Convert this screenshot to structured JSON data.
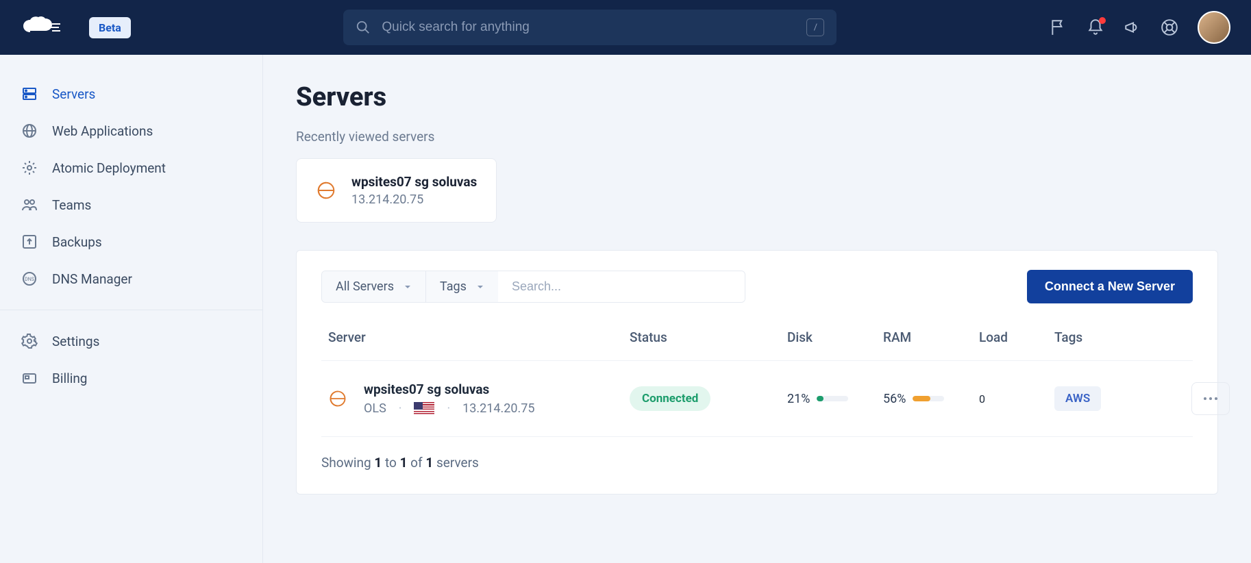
{
  "header": {
    "beta_label": "Beta",
    "search_placeholder": "Quick search for anything",
    "kbd_hint": "/"
  },
  "sidebar": {
    "items": [
      {
        "label": "Servers",
        "icon": "server-icon",
        "active": true
      },
      {
        "label": "Web Applications",
        "icon": "globe-icon",
        "active": false
      },
      {
        "label": "Atomic Deployment",
        "icon": "gear-outline-icon",
        "active": false
      },
      {
        "label": "Teams",
        "icon": "users-icon",
        "active": false
      },
      {
        "label": "Backups",
        "icon": "upload-box-icon",
        "active": false
      },
      {
        "label": "DNS Manager",
        "icon": "dns-icon",
        "active": false
      }
    ],
    "footer": [
      {
        "label": "Settings",
        "icon": "gear-icon"
      },
      {
        "label": "Billing",
        "icon": "card-icon"
      }
    ]
  },
  "page": {
    "title": "Servers",
    "recent_heading": "Recently viewed servers",
    "recent": [
      {
        "name": "wpsites07 sg soluvas",
        "ip": "13.214.20.75"
      }
    ],
    "filters": {
      "scope": "All Servers",
      "tags": "Tags",
      "search_placeholder": "Search..."
    },
    "connect_button": "Connect a New Server",
    "columns": {
      "server": "Server",
      "status": "Status",
      "disk": "Disk",
      "ram": "RAM",
      "load": "Load",
      "tags": "Tags"
    },
    "rows": [
      {
        "name": "wpsites07 sg soluvas",
        "stack": "OLS",
        "flag": "us",
        "ip": "13.214.20.75",
        "status": "Connected",
        "disk_pct": "21%",
        "disk_val": 21,
        "disk_color": "#1c9d6c",
        "ram_pct": "56%",
        "ram_val": 56,
        "ram_color": "#f0a030",
        "load": "0",
        "tag": "AWS"
      }
    ],
    "pagination": {
      "prefix": "Showing ",
      "from": "1",
      "mid1": " to ",
      "to": "1",
      "mid2": " of ",
      "total": "1",
      "suffix": " servers"
    }
  }
}
